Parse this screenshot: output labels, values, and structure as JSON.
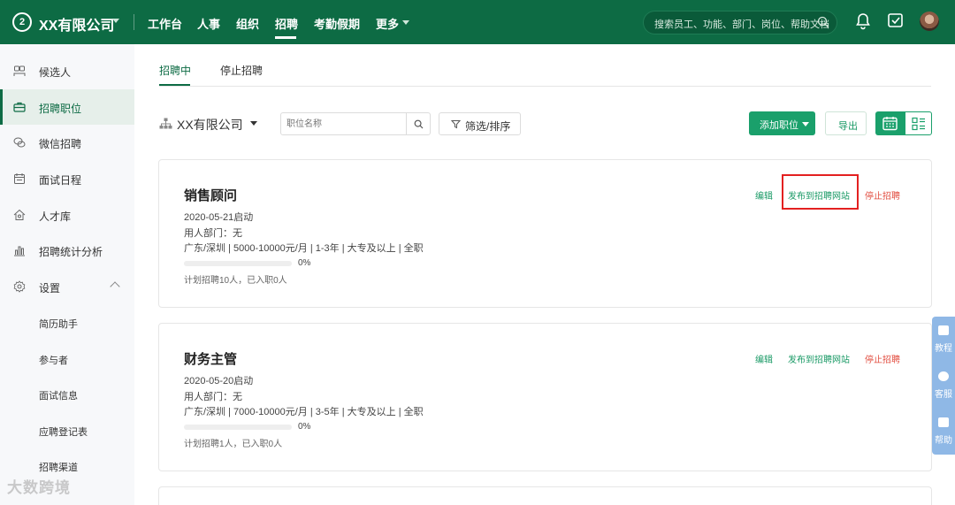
{
  "topbar": {
    "logo_text": "2",
    "company": "XX有限公司",
    "nav": [
      "工作台",
      "人事",
      "组织",
      "招聘",
      "考勤假期",
      "更多"
    ],
    "active_nav": "招聘",
    "search_placeholder": "搜索员工、功能、部门、岗位、帮助文档",
    "bg_color": "#0d6b44"
  },
  "sidebar": {
    "items": [
      {
        "label": "候选人",
        "icon": "people-icon"
      },
      {
        "label": "招聘职位",
        "icon": "briefcase-icon",
        "active": true
      },
      {
        "label": "微信招聘",
        "icon": "wechat-icon"
      },
      {
        "label": "面试日程",
        "icon": "calendar-icon"
      },
      {
        "label": "人才库",
        "icon": "home-icon"
      },
      {
        "label": "招聘统计分析",
        "icon": "bar-chart-icon"
      },
      {
        "label": "设置",
        "icon": "gear-icon"
      }
    ],
    "sub_items": [
      "简历助手",
      "参与者",
      "面试信息",
      "应聘登记表",
      "招聘渠道"
    ]
  },
  "watermark": "大数跨境",
  "tabs": [
    "招聘中",
    "停止招聘"
  ],
  "toolbar": {
    "org_name": "XX有限公司",
    "position_placeholder": "职位名称",
    "filter_label": "筛选/排序",
    "add_label": "添加职位",
    "export_label": "导出"
  },
  "jobs": [
    {
      "title": "销售顾问",
      "start": "2020-05-21启动",
      "dept": "用人部门：无",
      "details": "广东/深圳 | 5000-10000元/月 | 1-3年 | 大专及以上 | 全职",
      "progress_pct": 0,
      "progress_label": "0%",
      "plan": "计划招聘10人，已入职0人",
      "actions": {
        "edit": "编辑",
        "publish": "发布到招聘网站",
        "stop": "停止招聘"
      }
    },
    {
      "title": "财务主管",
      "start": "2020-05-20启动",
      "dept": "用人部门：无",
      "details": "广东/深圳 | 7000-10000元/月 | 3-5年 | 大专及以上 | 全职",
      "progress_pct": 0,
      "progress_label": "0%",
      "plan": "计划招聘1人，已入职0人",
      "actions": {
        "edit": "编辑",
        "publish": "发布到招聘网站",
        "stop": "停止招聘"
      }
    }
  ],
  "float_panel": [
    "教程",
    "客服",
    "帮助"
  ],
  "colors": {
    "accent": "#1aa06b",
    "danger": "#e24c3f",
    "highlight": "#e32020"
  }
}
